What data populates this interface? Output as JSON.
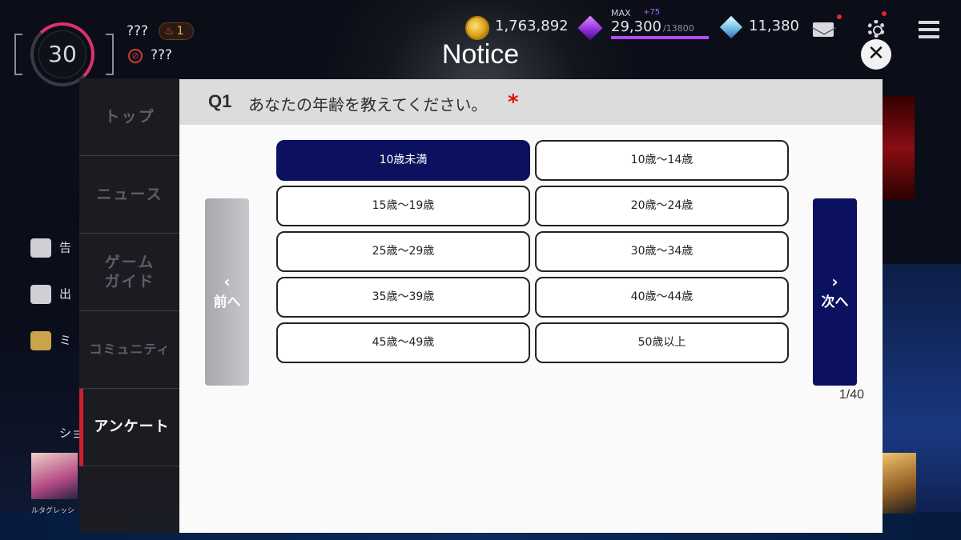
{
  "hud": {
    "level": "30",
    "player_name": "???",
    "rank": "1",
    "guild_name": "???",
    "coins": "1,763,892",
    "stamina_max_label": "MAX",
    "stamina_bonus": "+75",
    "stamina": "29,300",
    "stamina_cap": "/13800",
    "stamina_fill_fraction": 1.0,
    "gems": "11,380"
  },
  "dialog": {
    "title": "Notice",
    "close_label": "✕"
  },
  "side_menu": {
    "items": [
      {
        "label": "トップ"
      },
      {
        "label": "ニュース"
      },
      {
        "label": "ゲーム\nガイド"
      },
      {
        "label": "コミュニティ"
      },
      {
        "label": "アンケート"
      }
    ],
    "active_index": 4
  },
  "outer_menu": {
    "items": [
      {
        "label": "告"
      },
      {
        "label": "出"
      },
      {
        "label": "ミ"
      },
      {
        "label": "ショ"
      }
    ],
    "avatar_caption": "ルタグレッシ"
  },
  "question": {
    "number": "Q1",
    "text": "あなたの年齢を教えてください。",
    "required_mark": "*",
    "options": [
      "10歳未満",
      "10歳～14歳",
      "15歳～19歳",
      "20歳～24歳",
      "25歳～29歳",
      "30歳～34歳",
      "35歳～39歳",
      "40歳～44歳",
      "45歳～49歳",
      "50歳以上"
    ],
    "selected_index": 0
  },
  "navigation": {
    "prev_arrow": "‹",
    "prev_label": "前へ",
    "next_arrow": "›",
    "next_label": "次へ",
    "page": "1/40"
  },
  "colors": {
    "selected_option": "#0b115e",
    "next_button": "#0b115e",
    "required": "#e01010",
    "active_menu_marker": "#d01f2a"
  }
}
